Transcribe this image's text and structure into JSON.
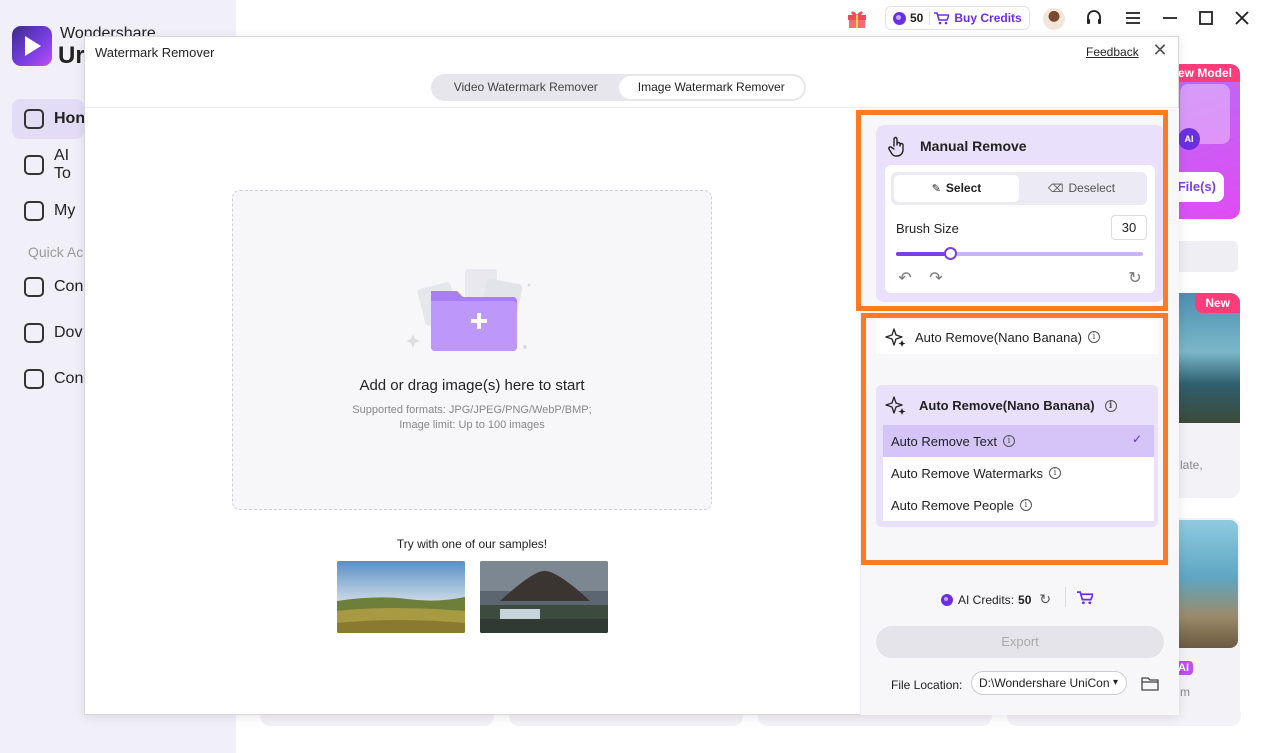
{
  "app": {
    "brand_line1": "Wondershare",
    "brand_line2": "Ur",
    "nav": [
      "Hon",
      "AI To",
      "My"
    ],
    "quick_label": "Quick Ac",
    "quick": [
      "Con",
      "Dov",
      "Con"
    ],
    "top_credits": "50",
    "buy_credits": "Buy Credits",
    "right_cards": {
      "new_model": "ew Model",
      "files_btn": "File(s)",
      "new_badge": "New",
      "late_text": "late,",
      "ai_badge": "AI",
      "m_text": "m"
    }
  },
  "dialog": {
    "title": "Watermark Remover",
    "feedback": "Feedback",
    "close": "✕",
    "tabs": [
      "Video Watermark Remover",
      "Image Watermark Remover"
    ],
    "active_tab": 1,
    "dropzone": {
      "title": "Add or drag image(s) here to start",
      "formats": "Supported formats: JPG/JPEG/PNG/WebP/BMP;",
      "limit": "Image limit: Up to 100 images"
    },
    "samples_label": "Try with one of our samples!"
  },
  "panel": {
    "manual_title": "Manual Remove",
    "select_label": "Select",
    "deselect_label": "Deselect",
    "brush_label": "Brush Size",
    "brush_value": "30",
    "brush_fraction": 0.22,
    "auto_row_label": "Auto Remove(Nano Banana)",
    "auto_menu_title": "Auto Remove(Nano Banana)",
    "auto_options": [
      "Auto Remove Text",
      "Auto Remove Watermarks",
      "Auto Remove People"
    ],
    "selected_option": 0,
    "ai_credits_label": "AI Credits:",
    "ai_credits_value": "50",
    "export_label": "Export",
    "file_location_label": "File Location:",
    "file_location_value": "D:\\Wondershare UniCon"
  },
  "colors": {
    "accent": "#7b3fe4",
    "highlight": "#ff7a22",
    "panel_tint": "#e9e0fb"
  }
}
